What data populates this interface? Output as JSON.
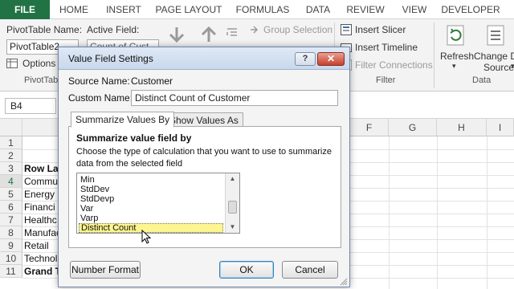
{
  "ribbon_tabs": [
    "FILE",
    "HOME",
    "INSERT",
    "PAGE LAYOUT",
    "FORMULAS",
    "DATA",
    "REVIEW",
    "VIEW",
    "DEVELOPER"
  ],
  "pivot": {
    "name_label": "PivotTable Name:",
    "name_value": "PivotTable2",
    "options_label": "Options",
    "group_label": "PivotTable"
  },
  "active_field": {
    "label": "Active Field:",
    "value": "Count of Cust..."
  },
  "group": {
    "selection_label": "Group Selection"
  },
  "filter": {
    "slicer_label": "Insert Slicer",
    "timeline_label": "Insert Timeline",
    "connections_label": "Filter Connections",
    "group_label": "Filter"
  },
  "data_group": {
    "refresh_label": "Refresh",
    "change_label_1": "Change Da",
    "change_label_2": "Source",
    "group_label": "Data"
  },
  "formula_bar": {
    "name_box": "B4"
  },
  "sheet": {
    "columns": [
      "F",
      "G",
      "H",
      "I"
    ],
    "rows": [
      {
        "num": "1",
        "text": ""
      },
      {
        "num": "2",
        "text": ""
      },
      {
        "num": "3",
        "text": "Row La"
      },
      {
        "num": "4",
        "text": "Commu"
      },
      {
        "num": "5",
        "text": "Energy"
      },
      {
        "num": "6",
        "text": "Financi"
      },
      {
        "num": "7",
        "text": "Healthc"
      },
      {
        "num": "8",
        "text": "Manufac"
      },
      {
        "num": "9",
        "text": "Retail"
      },
      {
        "num": "10",
        "text": "Technol"
      },
      {
        "num": "11",
        "text": "Grand T"
      }
    ]
  },
  "dialog": {
    "title": "Value Field Settings",
    "help": "?",
    "close": "✕",
    "source_name_label": "Source Name:",
    "source_name_value": "Customer",
    "custom_name_label": "Custom Name:",
    "custom_name_value": "Distinct Count of Customer",
    "tab_summarize": "Summarize Values By",
    "tab_show": "Show Values As",
    "section_heading": "Summarize value field by",
    "description_1": "Choose the type of calculation that you want to use to summarize",
    "description_2": "data from the selected field",
    "list_items": [
      "Min",
      "StdDev",
      "StdDevp",
      "Var",
      "Varp",
      "Distinct Count"
    ],
    "selected_item": "Distinct Count",
    "number_format_button": "Number Format",
    "ok_button": "OK",
    "cancel_button": "Cancel"
  },
  "colors": {
    "file_tab": "#217346",
    "selection_highlight": "#fdf58f",
    "close_button": "#c7402e"
  }
}
